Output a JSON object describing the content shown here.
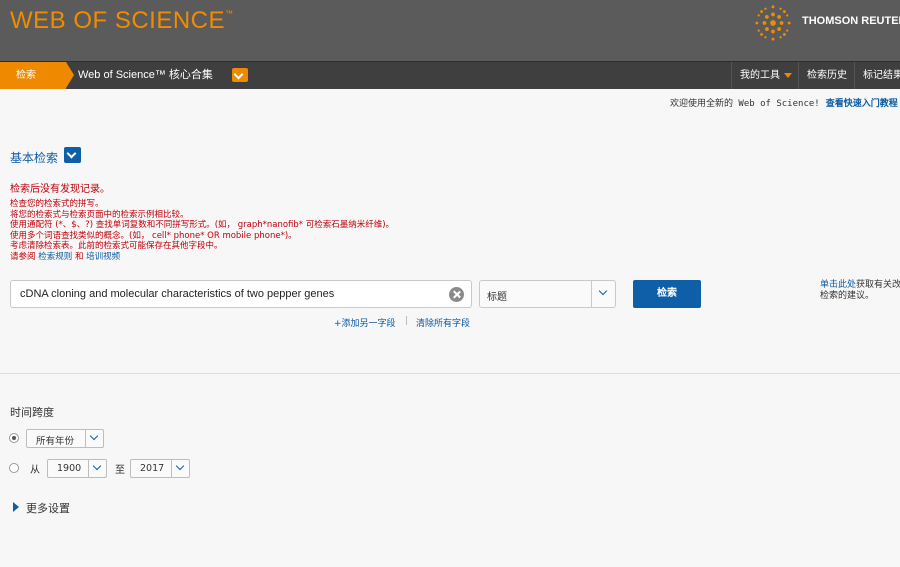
{
  "header": {
    "brand": "WEB OF SCIENCE",
    "brand_tm": "™",
    "vendor": "THOMSON REUTERS"
  },
  "nav": {
    "search_tab": "检索",
    "database": "Web of Science™ 核心合集",
    "my_tools": "我的工具",
    "search_history": "检索历史",
    "marked_list": "标记结果列表"
  },
  "welcome": {
    "text": "欢迎使用全新的 Web of Science!",
    "link": "查看快速入门教程"
  },
  "basic_search": {
    "title": "基本检索",
    "error_title": "检索后没有发现记录。",
    "tips": [
      "检查您的检索式的拼写。",
      "将您的检索式与检索页面中的检索示例相比较。",
      "使用通配符 (*、$、?) 查找单词复数和不同拼写形式。(如， graph*nanofib* 可检索石墨纳米纤维)。",
      "使用多个词语查找类似的概念。(如， cell* phone* OR mobile phone*)。",
      "考虑清除检索表。此前的检索式可能保存在其他字段中。"
    ],
    "see_also_prefix": "请参阅",
    "search_rules_link": "检索规则",
    "and_text": "和",
    "training_link": "培训视频",
    "query_value": "cDNA cloning and molecular characteristics of two pepper genes",
    "field_value": "标题",
    "search_button": "检索",
    "add_field": "+添加另一字段",
    "separator": "|",
    "clear_all": "清除所有字段",
    "side_tip_link": "单击此处",
    "side_tip_line1": "获取有关改进",
    "side_tip_line2": "检索的建议。"
  },
  "timespan": {
    "title": "时间跨度",
    "all_years": "所有年份",
    "from_label": "从",
    "from_year": "1900",
    "to_label": "至",
    "to_year": "2017"
  },
  "more_settings": "更多设置",
  "colors": {
    "orange": "#ef8a00",
    "header_bg": "#5b5b5b",
    "nav_bg": "#3f3f3f",
    "blue": "#0f5ea8",
    "error": "#c0000b"
  }
}
